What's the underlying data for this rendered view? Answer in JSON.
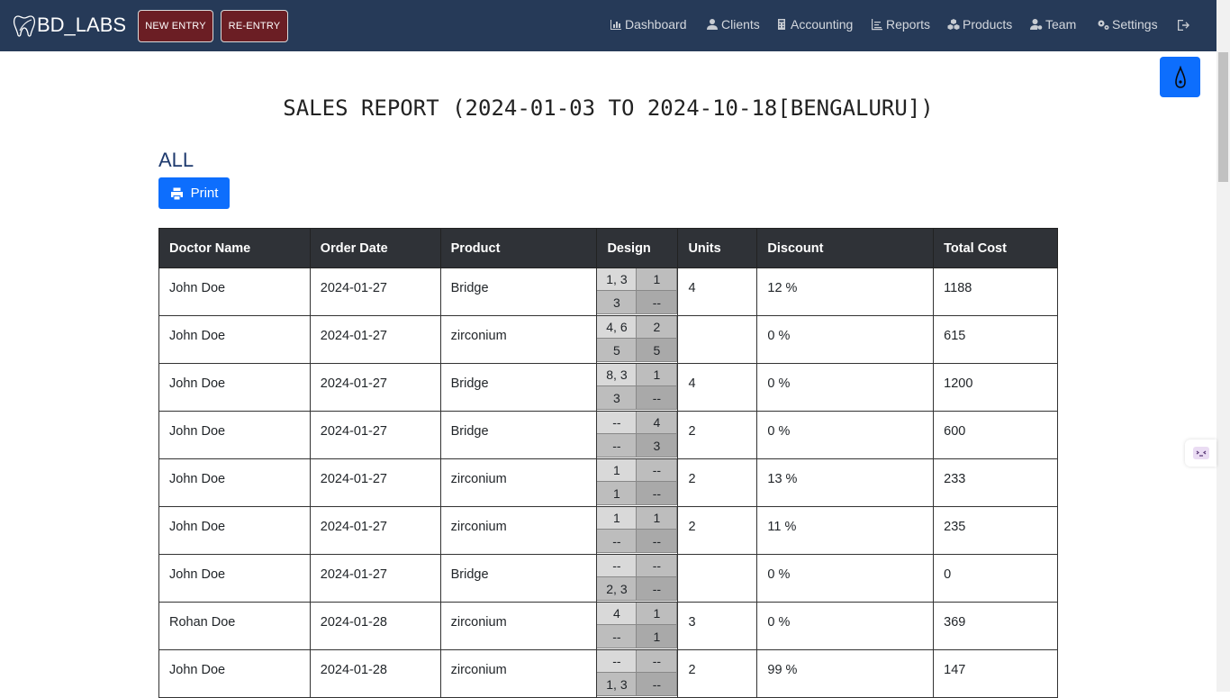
{
  "nav": {
    "brand": "BD_LABS",
    "new_entry": "NEW ENTRY",
    "re_entry": "RE-ENTRY",
    "items": [
      {
        "label": "Dashboard",
        "icon": "dashboard-icon"
      },
      {
        "label": "Clients",
        "icon": "users-icon"
      },
      {
        "label": "Accounting",
        "icon": "calculator-icon"
      },
      {
        "label": "Reports",
        "icon": "chart-icon"
      },
      {
        "label": "Products",
        "icon": "cubes-icon"
      },
      {
        "label": "Team",
        "icon": "user-gear-icon"
      },
      {
        "label": "Settings",
        "icon": "gears-icon"
      }
    ]
  },
  "page": {
    "title": "SALES REPORT (2024-01-03 TO 2024-10-18[BENGALURU])",
    "subtitle": "ALL",
    "print": "Print"
  },
  "table": {
    "headers": [
      "Doctor Name",
      "Order Date",
      "Product",
      "Design",
      "Units",
      "Discount",
      "Total Cost"
    ],
    "rows": [
      {
        "doctor": "John Doe",
        "date": "2024-01-27",
        "product": "Bridge",
        "design": [
          "1, 3",
          "1",
          "3",
          "--"
        ],
        "units": "4",
        "discount": "12 %",
        "total": "1188"
      },
      {
        "doctor": "John Doe",
        "date": "2024-01-27",
        "product": "zirconium",
        "design": [
          "4, 6",
          "2",
          "5",
          "5"
        ],
        "units": "",
        "discount": "0 %",
        "total": "615"
      },
      {
        "doctor": "John Doe",
        "date": "2024-01-27",
        "product": "Bridge",
        "design": [
          "8, 3",
          "1",
          "3",
          "--"
        ],
        "units": "4",
        "discount": "0 %",
        "total": "1200"
      },
      {
        "doctor": "John Doe",
        "date": "2024-01-27",
        "product": "Bridge",
        "design": [
          "--",
          "4",
          "--",
          "3"
        ],
        "units": "2",
        "discount": "0 %",
        "total": "600"
      },
      {
        "doctor": "John Doe",
        "date": "2024-01-27",
        "product": "zirconium",
        "design": [
          "1",
          "--",
          "1",
          "--"
        ],
        "units": "2",
        "discount": "13 %",
        "total": "233"
      },
      {
        "doctor": "John Doe",
        "date": "2024-01-27",
        "product": "zirconium",
        "design": [
          "1",
          "1",
          "--",
          "--"
        ],
        "units": "2",
        "discount": "11 %",
        "total": "235"
      },
      {
        "doctor": "John Doe",
        "date": "2024-01-27",
        "product": "Bridge",
        "design": [
          "--",
          "--",
          "2, 3",
          "--"
        ],
        "units": "",
        "discount": "0 %",
        "total": "0"
      },
      {
        "doctor": "Rohan Doe",
        "date": "2024-01-28",
        "product": "zirconium",
        "design": [
          "4",
          "1",
          "--",
          "1"
        ],
        "units": "3",
        "discount": "0 %",
        "total": "369"
      },
      {
        "doctor": "John Doe",
        "date": "2024-01-28",
        "product": "zirconium",
        "design": [
          "--",
          "--",
          "1, 3",
          "--"
        ],
        "units": "2",
        "discount": "99 %",
        "total": "147"
      }
    ]
  },
  "colors": {
    "navbar": "#263a58",
    "entry_button": "#6b1e24",
    "primary": "#0d6efd",
    "subtitle": "#1e3a6e"
  }
}
